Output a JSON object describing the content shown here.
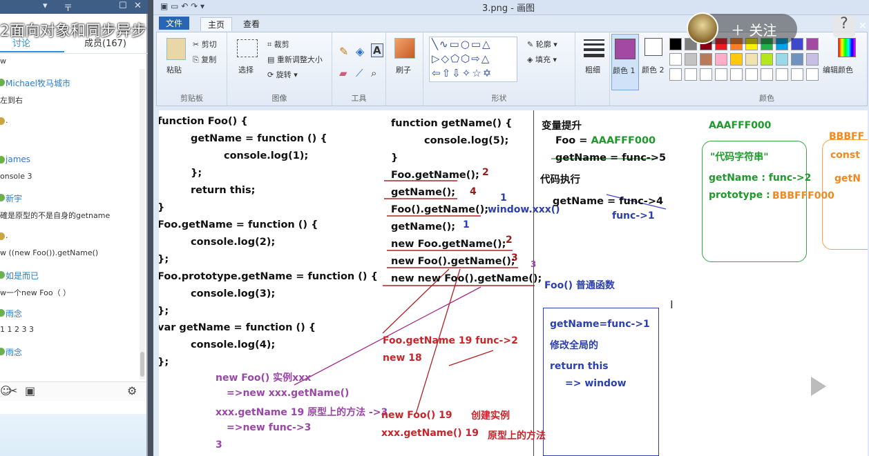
{
  "video": {
    "title": "2面向对象和同步异步",
    "follow_label": "关注",
    "help_label": "?"
  },
  "chat": {
    "top_icons": [
      "▾",
      "〒",
      "☐",
      "✕"
    ],
    "tabs": [
      "讨论",
      "成员(167)"
    ],
    "messages": [
      {
        "name": "",
        "text": "w"
      },
      {
        "name": "Michael牧马城市",
        "text": "左到右"
      },
      {
        "name": "",
        "text": "."
      },
      {
        "name": "james",
        "text": "onsole 3"
      },
      {
        "name": "新宇",
        "text": "確是原型的不是自身的getname"
      },
      {
        "name": "",
        "text": "."
      },
      {
        "name": "",
        "text": "w ((new Foo()).getName()"
      },
      {
        "name": "如是而已",
        "text": "w一个new Foo（ ）"
      },
      {
        "name": "雨念",
        "text": "1 1 2 3 3"
      },
      {
        "name": "雨念",
        "text": ""
      }
    ],
    "bottom_icons": [
      "☺",
      "✂",
      "▣",
      "⚙"
    ]
  },
  "paint": {
    "window_title": "3.png - 画图",
    "menus": [
      "文件",
      "主页",
      "查看"
    ],
    "groups": {
      "clipboard": {
        "label": "剪贴板",
        "paste": "粘贴",
        "cut": "剪切",
        "copy": "复制"
      },
      "image": {
        "label": "图像",
        "select": "选择",
        "crop": "裁剪",
        "resize": "重新调整大小",
        "rotate": "旋转"
      },
      "tools": {
        "label": "工具"
      },
      "brush": {
        "label": "刷子"
      },
      "shapes": {
        "label": "形状",
        "outline": "轮廓",
        "fill": "填充"
      },
      "size": {
        "label": "粗细"
      },
      "color1": {
        "label": "颜色 1"
      },
      "color2": {
        "label": "颜色 2"
      },
      "colors": {
        "label": "颜色",
        "edit": "编辑颜色"
      }
    },
    "palette": [
      "#000000",
      "#7f7f7f",
      "#880015",
      "#ed1c24",
      "#ff7f27",
      "#fff200",
      "#22b14c",
      "#00a2e8",
      "#3f48cc",
      "#a349a4",
      "#ffffff",
      "#c3c3c3",
      "#b97a57",
      "#ffaec9",
      "#ffc90e",
      "#efe4b0",
      "#b5e61d",
      "#99d9ea",
      "#7092be",
      "#c8bfe7"
    ],
    "color1_value": "#a349a4"
  },
  "canvas": {
    "code_left": [
      "function Foo() {",
      "getName = function () {",
      "console.log(1);",
      "};",
      "return this;",
      "}",
      "Foo.getName = function () {",
      "console.log(2);",
      "};",
      "Foo.prototype.getName = function () {",
      "console.log(3);",
      "};",
      "var getName = function () {",
      "console.log(4);",
      "};"
    ],
    "code_mid": [
      "function getName() {",
      "console.log(5);",
      "}",
      "Foo.getName();",
      "getName();",
      "Foo().getName();",
      "getName();",
      "new Foo.getName();",
      "new Foo().getName();",
      "new new Foo().getName();"
    ],
    "mid_answers": [
      "2",
      "4",
      "1",
      "1",
      "2",
      "3",
      "3"
    ],
    "window_xxx": "window.xxx()",
    "foo_normal": "Foo() 普通函数",
    "purple_notes": [
      "new Foo()   实例xxx",
      "=>new xxx.getName()",
      "xxx.getName  19   原型上的方法  ->3",
      "=>new func->3",
      "3"
    ],
    "red_notes": [
      "Foo.getName   19    func->2",
      "new  18",
      "new Foo() 19",
      "创建实例",
      "xxx.getName() 19",
      "原型上的方法"
    ],
    "right": {
      "hoist_title": "变量提升",
      "foo_assign": "Foo = ",
      "foo_value": "AAAFFF000",
      "getname_hoist": "getName = func->5",
      "exec_title": "代码执行",
      "getname_exec": "getName = func->4",
      "func1": "func->1",
      "addr_a": "AAAFFF000",
      "code_string": "\"代码字符串\"",
      "getname_func2": "getName : func->2",
      "prototype_label": "prototype :",
      "addr_b": "BBBFFF000",
      "addr_b_cut": "BBBFF",
      "const_cut": "const",
      "getn_cut": "getN",
      "box_lines": [
        "getName=func->1",
        "修改全局的",
        "return this",
        "=> window"
      ]
    }
  }
}
